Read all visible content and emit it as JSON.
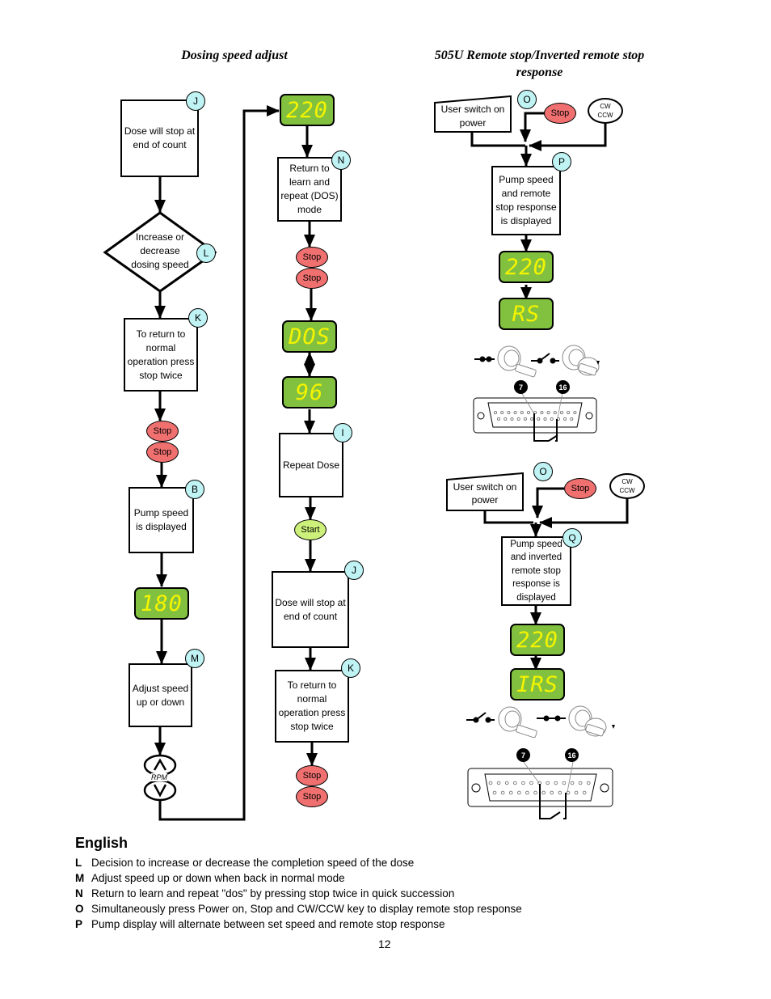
{
  "headings": {
    "left": "Dosing speed adjust",
    "right": "505U Remote stop/Inverted remote stop response"
  },
  "left_flow": {
    "box_j": {
      "label": "J",
      "text": "Dose will stop at end of count"
    },
    "decision_l": {
      "label": "L",
      "text": "Increase or decrease dosing speed"
    },
    "box_k": {
      "label": "K",
      "text": "To return to normal operation press stop twice"
    },
    "stop_keys": [
      "Stop",
      "Stop"
    ],
    "box_b": {
      "label": "B",
      "text": "Pump speed is displayed"
    },
    "display": "180",
    "box_m": {
      "label": "M",
      "text": "Adjust speed up or down"
    },
    "rpm_label": "RPM",
    "up_icon": "chevron-up-icon",
    "down_icon": "chevron-down-icon"
  },
  "middle_flow": {
    "display_top": "220",
    "box_n": {
      "label": "N",
      "text": "Return to learn and repeat (DOS) mode"
    },
    "stop_keys": [
      "Stop",
      "Stop"
    ],
    "display_dos": "DOS",
    "display_count": "96",
    "box_i": {
      "label": "I",
      "text": "Repeat Dose"
    },
    "start_key": "Start",
    "box_j": {
      "label": "J",
      "text": "Dose will stop at end of count"
    },
    "box_k": {
      "label": "K",
      "text": "To return to normal operation press stop twice"
    },
    "stop_keys_bottom": [
      "Stop",
      "Stop"
    ]
  },
  "right_top": {
    "user_switch": "User switch on power",
    "label_o": "O",
    "stop_key": "Stop",
    "cw_key": [
      "CW",
      "CCW"
    ],
    "box_p": {
      "label": "P",
      "text": "Pump speed and remote stop response is displayed"
    },
    "display_speed": "220",
    "display_mode": "RS",
    "pins": [
      "7",
      "16"
    ]
  },
  "right_bottom": {
    "user_switch": "User switch on power",
    "label_o": "O",
    "stop_key": "Stop",
    "cw_key": [
      "CW",
      "CCW"
    ],
    "box_q": {
      "label": "Q",
      "text": "Pump speed and inverted remote stop response is displayed"
    },
    "display_speed": "220",
    "display_mode": "IRS",
    "pins": [
      "7",
      "16"
    ]
  },
  "legend": {
    "title": "English",
    "items": [
      {
        "key": "L",
        "text": "Decision to increase or decrease the completion speed of the dose"
      },
      {
        "key": "M",
        "text": "Adjust speed up or down when back in normal mode"
      },
      {
        "key": "N",
        "text": "Return to learn and repeat \"dos\" by pressing stop twice in quick succession"
      },
      {
        "key": "O",
        "text": "Simultaneously press Power on, Stop and CW/CCW key to display remote stop response"
      },
      {
        "key": "P",
        "text": "Pump display will alternate between set speed and remote stop response"
      }
    ]
  },
  "page_number": "12"
}
